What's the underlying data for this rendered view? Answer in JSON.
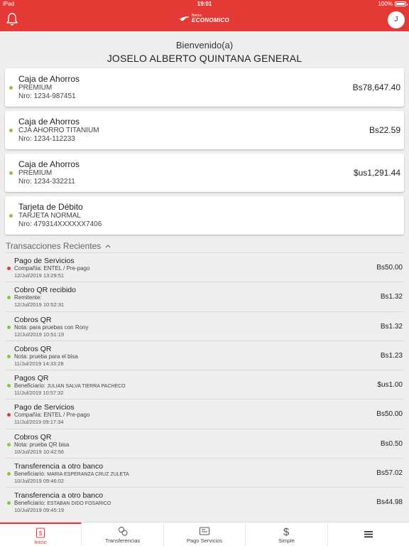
{
  "status_bar": {
    "device": "iPad",
    "time": "19:01",
    "battery": "100%"
  },
  "header": {
    "logo_small": "Banco",
    "logo_big": "ECONOMICO",
    "avatar_initial": "J",
    "icons": {
      "left": "bell-icon",
      "right": "avatar"
    }
  },
  "welcome": {
    "greeting": "Bienvenido(a)",
    "name": "JOSELO ALBERTO QUINTANA GENERAL"
  },
  "accounts": [
    {
      "title": "Caja de Ahorros",
      "type": "PREMIUM",
      "number": "Nro: 1234-987451",
      "balance": "Bs78,647.40"
    },
    {
      "title": "Caja de Ahorros",
      "type": "CJA AHORRO TITANIUM",
      "number": "Nro: 1234-112233",
      "balance": "Bs22.59"
    },
    {
      "title": "Caja de Ahorros",
      "type": "PREMIUM",
      "number": "Nro: 1234-332211",
      "balance": "$us1,291.44"
    },
    {
      "title": "Tarjeta de Débito",
      "type": "TARJETA NORMAL",
      "number": "Nro: 479314XXXXXX7406",
      "balance": ""
    }
  ],
  "transactions_section": {
    "title": "Transacciones Recientes"
  },
  "transactions": [
    {
      "title": "Pago de Servicios",
      "detail_label": "Compañía: ENTEL / Pre-pago",
      "detail_name": "",
      "date": "12/Jul/2019 13:29:51",
      "amount": "Bs50.00",
      "status": "red"
    },
    {
      "title": "Cobro QR recibido",
      "detail_label": "Remitente:",
      "detail_name": "",
      "date": "12/Jul/2019 10:52:31",
      "amount": "Bs1.32",
      "status": "green"
    },
    {
      "title": "Cobros QR",
      "detail_label": "Nota: para pruebas con Rony",
      "detail_name": "",
      "date": "12/Jul/2019 10:51:19",
      "amount": "Bs1.32",
      "status": "green"
    },
    {
      "title": "Cobros QR",
      "detail_label": "Nota: prueba para el bisa",
      "detail_name": "",
      "date": "11/Jul/2019 14:33:28",
      "amount": "Bs1.23",
      "status": "green"
    },
    {
      "title": "Pagos QR",
      "detail_label": "Beneficiario:",
      "detail_name": "JULIAN SALVA TIERRA PACHECO",
      "date": "11/Jul/2019 10:57:32",
      "amount": "$us1.00",
      "status": "green"
    },
    {
      "title": "Pago de Servicios",
      "detail_label": "Compañía: ENTEL / Pre-pago",
      "detail_name": "",
      "date": "11/Jul/2019 09:17:34",
      "amount": "Bs50.00",
      "status": "red"
    },
    {
      "title": "Cobros QR",
      "detail_label": "Nota: prueba QR bisa",
      "detail_name": "",
      "date": "10/Jul/2019 10:42:56",
      "amount": "Bs0.50",
      "status": "green"
    },
    {
      "title": "Transferencia a otro banco",
      "detail_label": "Beneficiario:",
      "detail_name": "MARIA ESPERANZA CRUZ ZULETA",
      "date": "10/Jul/2019 09:46:02",
      "amount": "Bs57.02",
      "status": "green"
    },
    {
      "title": "Transferencia a otro banco",
      "detail_label": "Beneficiario:",
      "detail_name": "ESTABAN DIDO FOSARICO",
      "date": "10/Jul/2019 09:45:19",
      "amount": "Bs44.98",
      "status": "green"
    }
  ],
  "tabbar": [
    {
      "label": "Inicio",
      "icon": "bank-icon",
      "active": true
    },
    {
      "label": "Transferencias",
      "icon": "transfer-icon",
      "active": false
    },
    {
      "label": "Pago Servicios",
      "icon": "bill-icon",
      "active": false
    },
    {
      "label": "Simple",
      "icon": "dollar-icon",
      "active": false
    },
    {
      "label": "",
      "icon": "menu-icon",
      "active": false
    }
  ],
  "colors": {
    "brand": "#e53935",
    "status_ok": "#8bc34a",
    "status_error": "#e53935",
    "background": "#eeeeee"
  }
}
